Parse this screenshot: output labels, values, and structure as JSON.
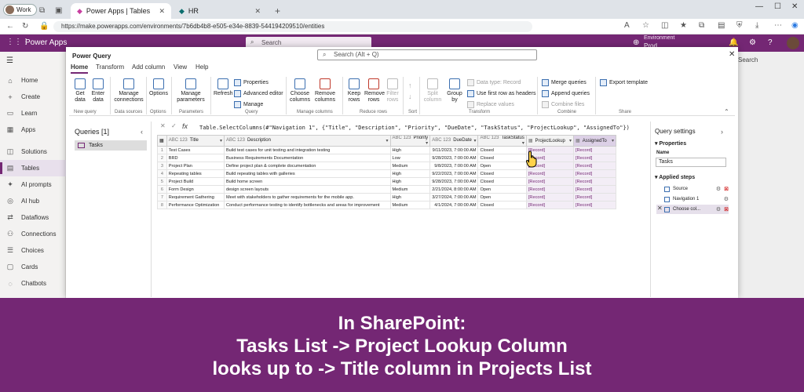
{
  "browser": {
    "profile": "Work",
    "tabs": [
      {
        "label": "Power Apps | Tables"
      },
      {
        "label": "HR"
      }
    ],
    "url": "https://make.powerapps.com/environments/7b6db4b8-e505-e34e-8839-544194209510/entities"
  },
  "app": {
    "title": "Power Apps",
    "search_placeholder": "Search",
    "env_label": "Environment",
    "env_name": "Prod",
    "page_search": "Search"
  },
  "nav": {
    "items": [
      {
        "label": "Home",
        "icon": "home-icon"
      },
      {
        "label": "Create",
        "icon": "plus-icon"
      },
      {
        "label": "Learn",
        "icon": "book-icon"
      },
      {
        "label": "Apps",
        "icon": "apps-icon"
      },
      {
        "label": "Solutions",
        "icon": "solutions-icon"
      },
      {
        "label": "Tables",
        "icon": "table-icon",
        "selected": true
      },
      {
        "label": "AI prompts",
        "icon": "ai-icon"
      },
      {
        "label": "AI hub",
        "icon": "hub-icon"
      },
      {
        "label": "Dataflows",
        "icon": "dataflow-icon"
      },
      {
        "label": "Connections",
        "icon": "connection-icon"
      },
      {
        "label": "Choices",
        "icon": "choices-icon"
      },
      {
        "label": "Cards",
        "icon": "cards-icon"
      },
      {
        "label": "Chatbots",
        "icon": "chatbot-icon"
      }
    ]
  },
  "pq": {
    "title": "Power Query",
    "search_placeholder": "Search (Alt + Q)",
    "menu_tabs": [
      "Home",
      "Transform",
      "Add column",
      "View",
      "Help"
    ],
    "ribbon": {
      "get_data": "Get data",
      "enter_data": "Enter data",
      "manage_connections": "Manage connections",
      "options": "Options",
      "manage_parameters": "Manage parameters",
      "refresh": "Refresh",
      "properties": "Properties",
      "advanced_editor": "Advanced editor",
      "manage": "Manage",
      "choose_columns": "Choose columns",
      "remove_columns": "Remove columns",
      "keep_rows": "Keep rows",
      "remove_rows": "Remove rows",
      "filter_rows": "Filter rows",
      "split_column": "Split column",
      "group_by": "Group by",
      "data_type": "Data type: Record",
      "use_first_row": "Use first row as headers",
      "replace_values": "Replace values",
      "merge_queries": "Merge queries",
      "append_queries": "Append queries",
      "combine_files": "Combine files",
      "export_template": "Export template",
      "groups": [
        "New query",
        "Data sources",
        "Options",
        "Parameters",
        "Query",
        "Manage columns",
        "Reduce rows",
        "Sort",
        "Transform",
        "Combine",
        "Share"
      ]
    },
    "queries_title": "Queries [1]",
    "query_item": "Tasks",
    "formula": "Table.SelectColumns(#\"Navigation 1\", {\"Title\", \"Description\", \"Priority\", \"DueDate\", \"TaskStatus\", \"ProjectLookup\", \"AssignedTo\"})",
    "columns": [
      {
        "type": "ABC 123",
        "name": "Title"
      },
      {
        "type": "ABC 123",
        "name": "Description"
      },
      {
        "type": "ABC 123",
        "name": "Priority"
      },
      {
        "type": "ABC 123",
        "name": "DueDate"
      },
      {
        "type": "ABC 123",
        "name": "TaskStatus"
      },
      {
        "type": "▦",
        "name": "ProjectLookup"
      },
      {
        "type": "▦",
        "name": "AssignedTo"
      }
    ],
    "rows": [
      [
        "Test Cases",
        "Build test cases for unit testing and integration testing",
        "High",
        "9/11/2023, 7:00:00 AM",
        "Closed",
        "[Record]",
        "[Record]"
      ],
      [
        "BRD",
        "Business Requirements Documentation",
        "Low",
        "9/28/2023, 7:00:00 AM",
        "Closed",
        "[Record]",
        "[Record]"
      ],
      [
        "Project Plan",
        "Define project plan & complete documentation",
        "Medium",
        "9/8/2023, 7:00:00 AM",
        "Open",
        "[Record]",
        "[Record]"
      ],
      [
        "Repeating tables",
        "Build repeating tables with galleries",
        "High",
        "9/22/2023, 7:00:00 AM",
        "Closed",
        "[Record]",
        "[Record]"
      ],
      [
        "Project Build",
        "Build home screen",
        "High",
        "9/28/2023, 7:00:00 AM",
        "Closed",
        "[Record]",
        "[Record]"
      ],
      [
        "Form Design",
        "design screen layouts",
        "Medium",
        "2/21/2024, 8:00:00 AM",
        "Open",
        "[Record]",
        "[Record]"
      ],
      [
        "Requirement Gathering",
        "Meet with stakeholders to gather requirements for the mobile app.",
        "High",
        "3/27/2024, 7:00:00 AM",
        "Open",
        "[Record]",
        "[Record]"
      ],
      [
        "Performance Optimization",
        "Conduct performance testing to identify bottlenecks and areas for improvement",
        "Medium",
        "4/1/2024, 7:00:00 AM",
        "Closed",
        "[Record]",
        "[Record]"
      ]
    ],
    "settings": {
      "title": "Query settings",
      "properties": "Properties",
      "name_label": "Name",
      "name_value": "Tasks",
      "steps_title": "Applied steps",
      "steps": [
        "Source",
        "Navigation 1",
        "Choose col..."
      ]
    }
  },
  "caption": {
    "line1": "In SharePoint:",
    "line2": "Tasks List -> Project Lookup Column",
    "line3": "looks up to -> Title column in Projects List"
  },
  "colors": {
    "brand": "#742774",
    "accent": "#3c6fb0"
  }
}
